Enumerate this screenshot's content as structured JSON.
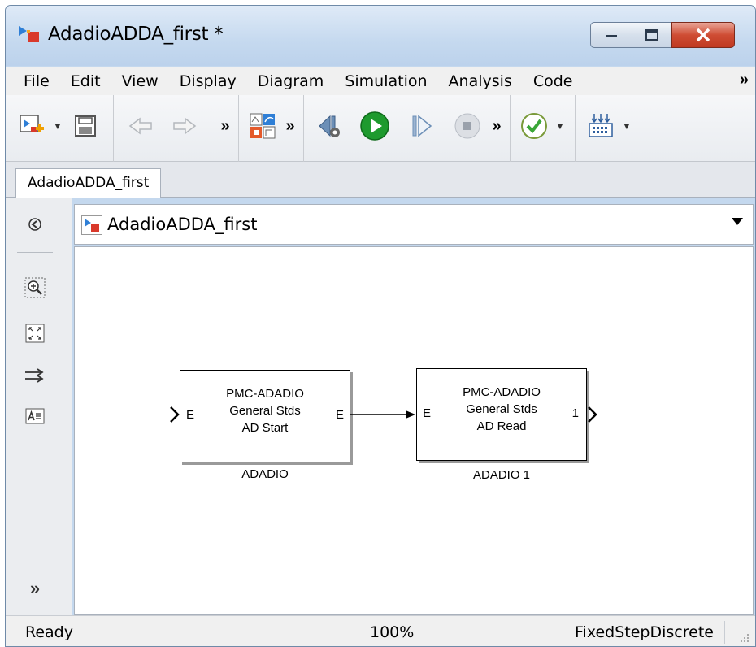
{
  "window": {
    "title": "AdadioADDA_first *"
  },
  "menubar": {
    "items": [
      "File",
      "Edit",
      "View",
      "Display",
      "Diagram",
      "Simulation",
      "Analysis",
      "Code"
    ],
    "more": "»"
  },
  "toolbar": {
    "more": "»"
  },
  "tabs": [
    {
      "label": "AdadioADDA_first"
    }
  ],
  "address": {
    "path": "AdadioADDA_first"
  },
  "palette": {
    "more": "»"
  },
  "blocks": [
    {
      "lines": [
        "PMC-ADADIO",
        "General Stds",
        "AD Start"
      ],
      "in_port": "E",
      "out_port": "E",
      "name": "ADADIO"
    },
    {
      "lines": [
        "PMC-ADADIO",
        "General Stds",
        "AD Read"
      ],
      "in_port": "E",
      "out_port": "1",
      "name": "ADADIO 1"
    }
  ],
  "status": {
    "state": "Ready",
    "zoom": "100%",
    "solver": "FixedStepDiscrete"
  },
  "colors": {
    "run": "#1e9a2e",
    "check": "#3aa637",
    "close": "#c8452c",
    "model_icon_red": "#d9392b",
    "model_icon_blue": "#2f7fd6"
  }
}
